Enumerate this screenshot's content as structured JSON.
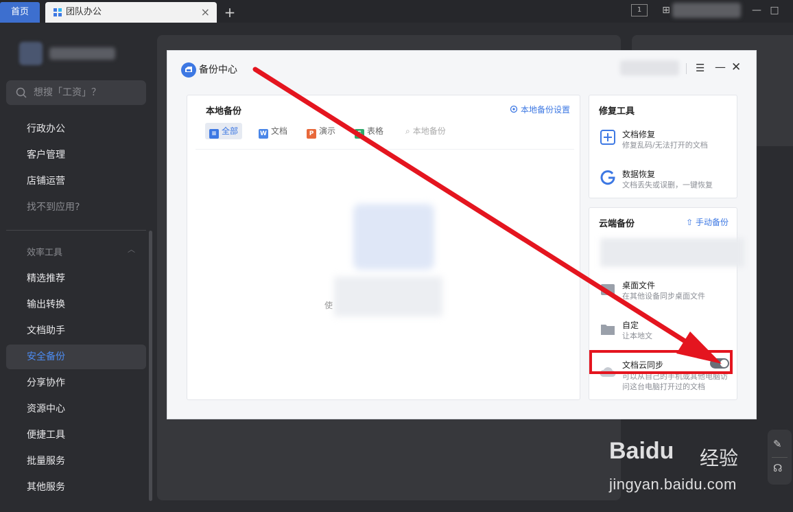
{
  "tabs": {
    "home": "首页",
    "team": "团队办公",
    "close": "×",
    "add": "+"
  },
  "window": {
    "layout": "1",
    "grid": "⊞",
    "min": "—",
    "max": "□"
  },
  "sidebar": {
    "search_placeholder": "想搜「工资」？",
    "items": [
      {
        "label": "行政办公"
      },
      {
        "label": "客户管理"
      },
      {
        "label": "店铺运营"
      },
      {
        "label": "找不到应用?"
      }
    ],
    "section": "效率工具",
    "tools": [
      {
        "label": "精选推荐"
      },
      {
        "label": "输出转换"
      },
      {
        "label": "文档助手"
      },
      {
        "label": "安全备份"
      },
      {
        "label": "分享协作"
      },
      {
        "label": "资源中心"
      },
      {
        "label": "便捷工具"
      },
      {
        "label": "批量服务"
      },
      {
        "label": "其他服务"
      }
    ]
  },
  "dialog": {
    "title": "备份中心",
    "local": {
      "title": "本地备份",
      "settings": "本地备份设置",
      "filters": [
        "全部",
        "文档",
        "演示",
        "表格",
        "本地备份"
      ],
      "empty_text": "使"
    },
    "repair": {
      "title": "修复工具",
      "items": [
        {
          "title": "文档修复",
          "desc": "修复乱码/无法打开的文档"
        },
        {
          "title": "数据恢复",
          "desc": "文档丢失或误删，一键恢复"
        }
      ]
    },
    "cloud": {
      "title": "云端备份",
      "manual": "手动备份",
      "items": [
        {
          "title": "桌面文件",
          "desc": "在其他设备同步桌面文件"
        },
        {
          "title": "自定",
          "desc": "让本地文"
        },
        {
          "title": "文档云同步",
          "desc": "可以从自己的手机或其他电脑访问这台电脑打开过的文档"
        }
      ]
    }
  },
  "watermark": {
    "logo": "Baidu",
    "cn": "经验",
    "url": "jingyan.baidu.com"
  },
  "colors": {
    "accent": "#3d78e3",
    "highlight": "#e4151f"
  }
}
